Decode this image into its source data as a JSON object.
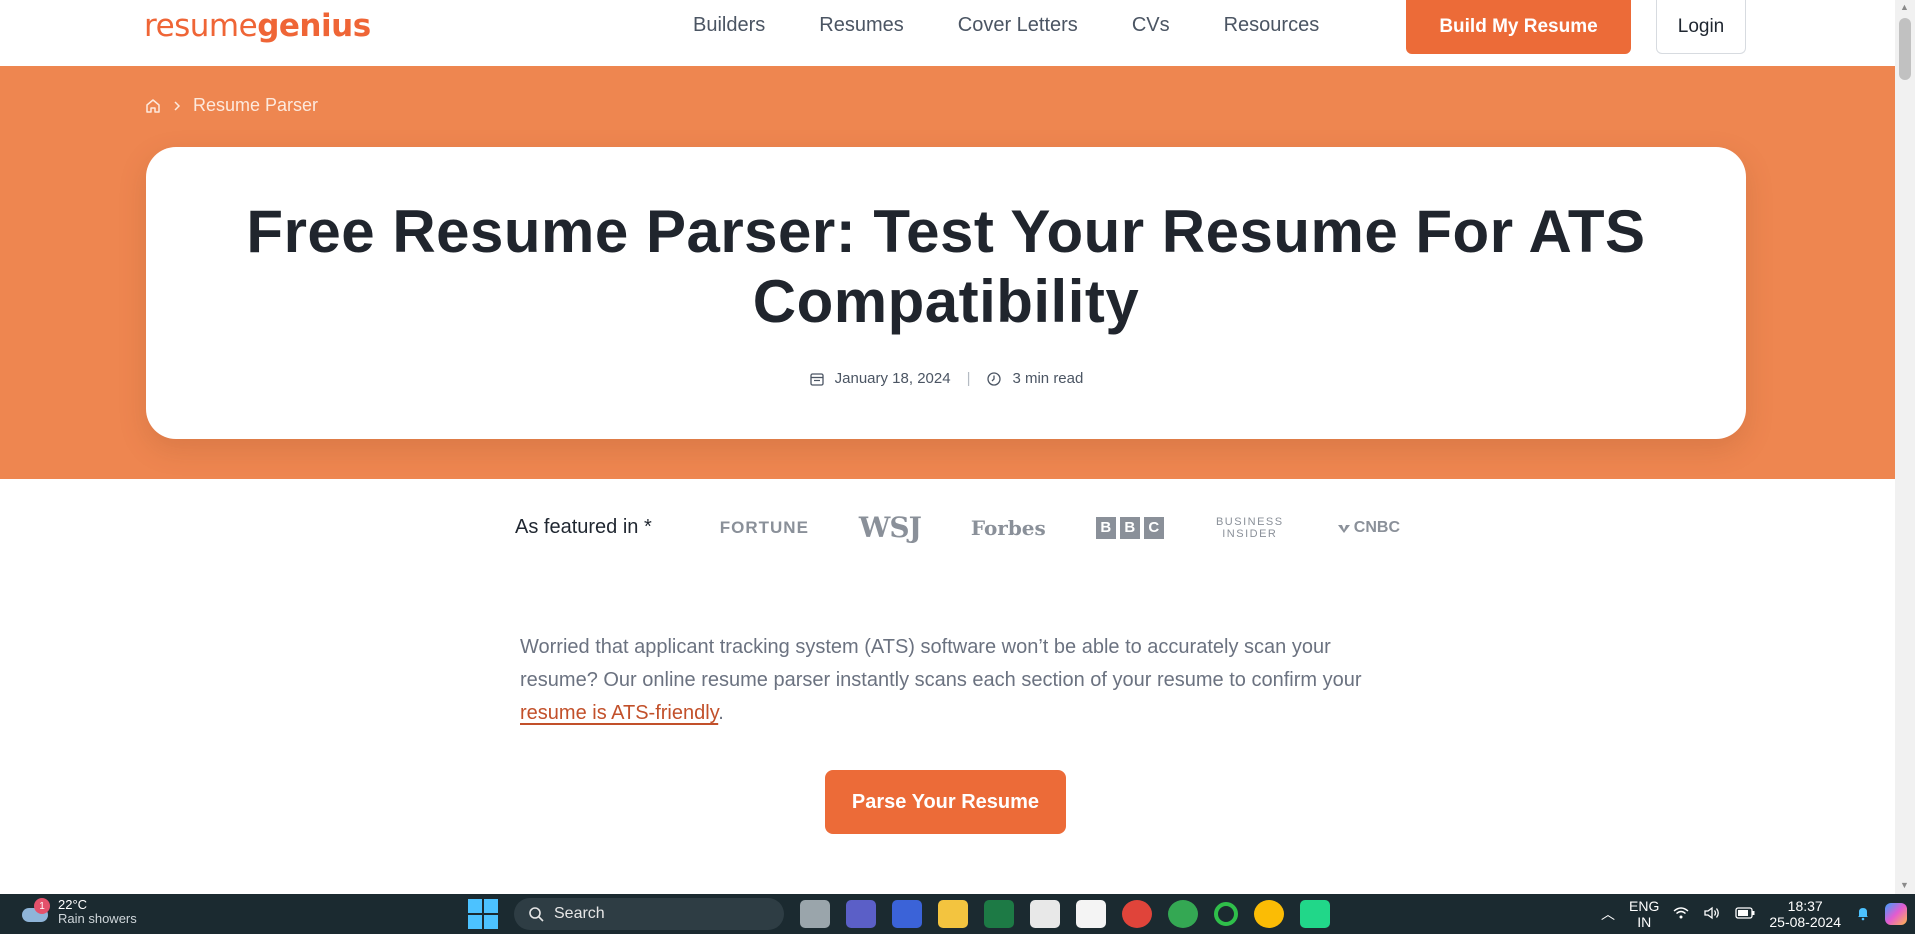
{
  "header": {
    "logo": {
      "light": "resume",
      "bold": "genius"
    },
    "nav": [
      "Builders",
      "Resumes",
      "Cover Letters",
      "CVs",
      "Resources"
    ],
    "build_button": "Build My Resume",
    "login_button": "Login"
  },
  "breadcrumb": {
    "home_icon": "home-icon",
    "current": "Resume Parser"
  },
  "hero": {
    "title": "Free Resume Parser: Test Your Resume For ATS Compatibility",
    "date": "January 18, 2024",
    "read_time": "3 min read"
  },
  "featured": {
    "label": "As featured in *",
    "publications": [
      "FORTUNE",
      "WSJ",
      "Forbes",
      "BBC",
      "BUSINESS INSIDER",
      "CNBC"
    ]
  },
  "intro": {
    "text_before": "Worried that applicant tracking system (ATS) software won’t be able to accurately scan your resume? Our online resume parser instantly scans each section of your resume to confirm your ",
    "link_text": "resume is ATS-friendly",
    "text_after": "."
  },
  "cta": {
    "parse_button": "Parse Your Resume"
  },
  "colors": {
    "brand": "#ec6b38",
    "hero_bg": "#ee8650",
    "text_dark": "#20252d"
  },
  "taskbar": {
    "weather": {
      "temp": "22°C",
      "condition": "Rain showers",
      "badge": "1"
    },
    "search_placeholder": "Search",
    "lang": "ENG",
    "region": "IN",
    "time": "18:37",
    "date": "25-08-2024"
  }
}
